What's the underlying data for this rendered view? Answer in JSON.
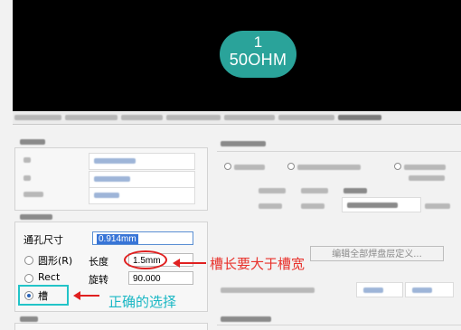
{
  "preview": {
    "pad_number": "1",
    "pad_net": "50OHM",
    "pad_color": "#2aa39a"
  },
  "hole_size": {
    "label": "通孔尺寸",
    "value": "0.914mm"
  },
  "shape": {
    "round_label": "圆形(R)",
    "rect_label": "Rect",
    "slot_label": "槽",
    "selected": "槽"
  },
  "length": {
    "label": "长度",
    "value": "1.5mm"
  },
  "rotation": {
    "label": "旋转",
    "value": "90.000"
  },
  "pad_stack": {
    "edit_button_label": "编辑全部焊盘层定义..."
  },
  "annotations": {
    "slot_length_note": "槽长要大于槽宽",
    "correct_choice_note": "正确的选择",
    "highlight_red": "#e02020",
    "highlight_cyan": "#22c4c8"
  }
}
